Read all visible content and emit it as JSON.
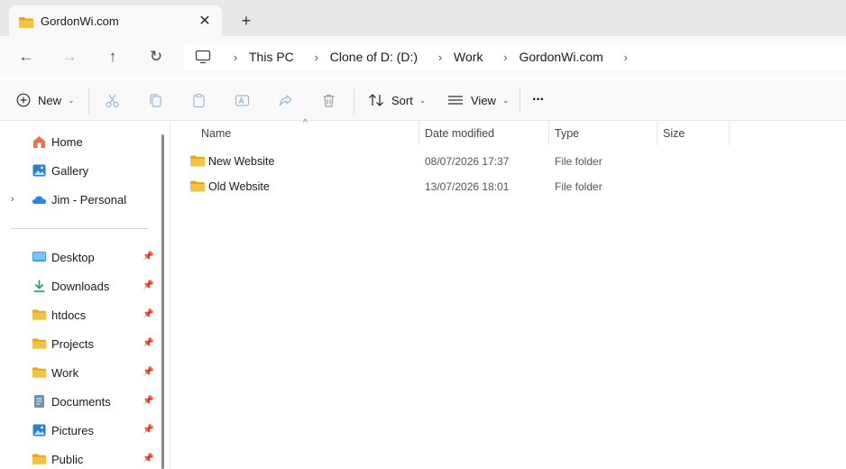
{
  "window": {
    "tab_title": "GordonWi.com",
    "tab_close": "✕",
    "new_tab": "+"
  },
  "nav": {
    "back": "←",
    "forward": "→",
    "up": "↑",
    "refresh": "↻"
  },
  "breadcrumb": {
    "items": [
      "This PC",
      "Clone of D: (D:)",
      "Work",
      "GordonWi.com"
    ],
    "separator": "›"
  },
  "toolbar": {
    "new_label": "New",
    "sort_label": "Sort",
    "view_label": "View",
    "more_label": "···",
    "dropdown_chevron": "⌄"
  },
  "sidebar": {
    "top_items": [
      {
        "label": "Home",
        "icon": "home-icon"
      },
      {
        "label": "Gallery",
        "icon": "gallery-icon"
      },
      {
        "label": "Jim - Personal",
        "icon": "onedrive-icon"
      }
    ],
    "quick_access": [
      {
        "label": "Desktop",
        "icon": "desktop-icon"
      },
      {
        "label": "Downloads",
        "icon": "downloads-icon"
      },
      {
        "label": "htdocs",
        "icon": "folder-icon"
      },
      {
        "label": "Projects",
        "icon": "folder-icon"
      },
      {
        "label": "Work",
        "icon": "folder-icon"
      },
      {
        "label": "Documents",
        "icon": "documents-icon"
      },
      {
        "label": "Pictures",
        "icon": "pictures-icon"
      },
      {
        "label": "Public",
        "icon": "folder-icon"
      }
    ],
    "expander": "›",
    "pin": "📌"
  },
  "columns": {
    "name": "Name",
    "date": "Date modified",
    "type": "Type",
    "size": "Size",
    "sort_indicator": "^"
  },
  "files": [
    {
      "name": "New Website",
      "date": "08/07/2026 17:37",
      "type": "File folder",
      "size": ""
    },
    {
      "name": "Old Website",
      "date": "13/07/2026 18:01",
      "type": "File folder",
      "size": ""
    }
  ],
  "colors": {
    "folder": "#f5c343",
    "folder_dark": "#e6a817",
    "accent": "#0067c0"
  }
}
